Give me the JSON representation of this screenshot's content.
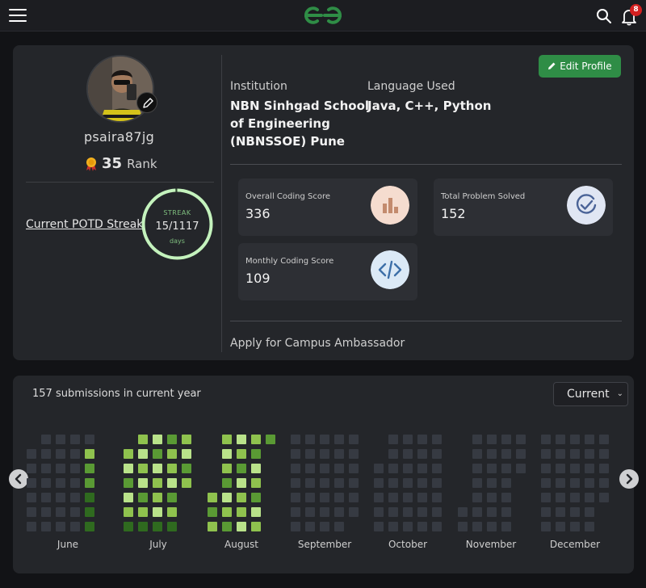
{
  "topbar": {
    "notification_count": "8"
  },
  "profile": {
    "username": "psaira87jg",
    "rank_number": "35",
    "rank_label": "Rank",
    "potd_link": "Current POTD Streak",
    "streak": {
      "label": "STREAK",
      "value": "15/1117",
      "unit": "days",
      "progress": 0.99
    },
    "edit_button": "Edit Profile",
    "institution_label": "Institution",
    "institution_lines": [
      "NBN Sinhgad School",
      "of Engineering",
      "(NBNSSOE) Pune"
    ],
    "language_label": "Language Used",
    "language_value": "Java, C++, Python",
    "stats": {
      "overall": {
        "label": "Overall Coding Score",
        "value": "336"
      },
      "solved": {
        "label": "Total Problem Solved",
        "value": "152"
      },
      "monthly": {
        "label": "Monthly Coding Score",
        "value": "109"
      }
    },
    "campus_link": "Apply for Campus Ambassador"
  },
  "heatmap": {
    "submissions_text": "157 submissions in current year",
    "year_select": "Current",
    "months": [
      "June",
      "July",
      "August",
      "September",
      "October",
      "November",
      "December"
    ]
  },
  "colors": {
    "brand_green": "#2f8d46",
    "cell_empty": "#363a42",
    "cell_low": "#2f6a1f",
    "cell_mid": "#5a9a34",
    "cell_high": "#8fc24e",
    "cell_max": "#b9e28a"
  }
}
